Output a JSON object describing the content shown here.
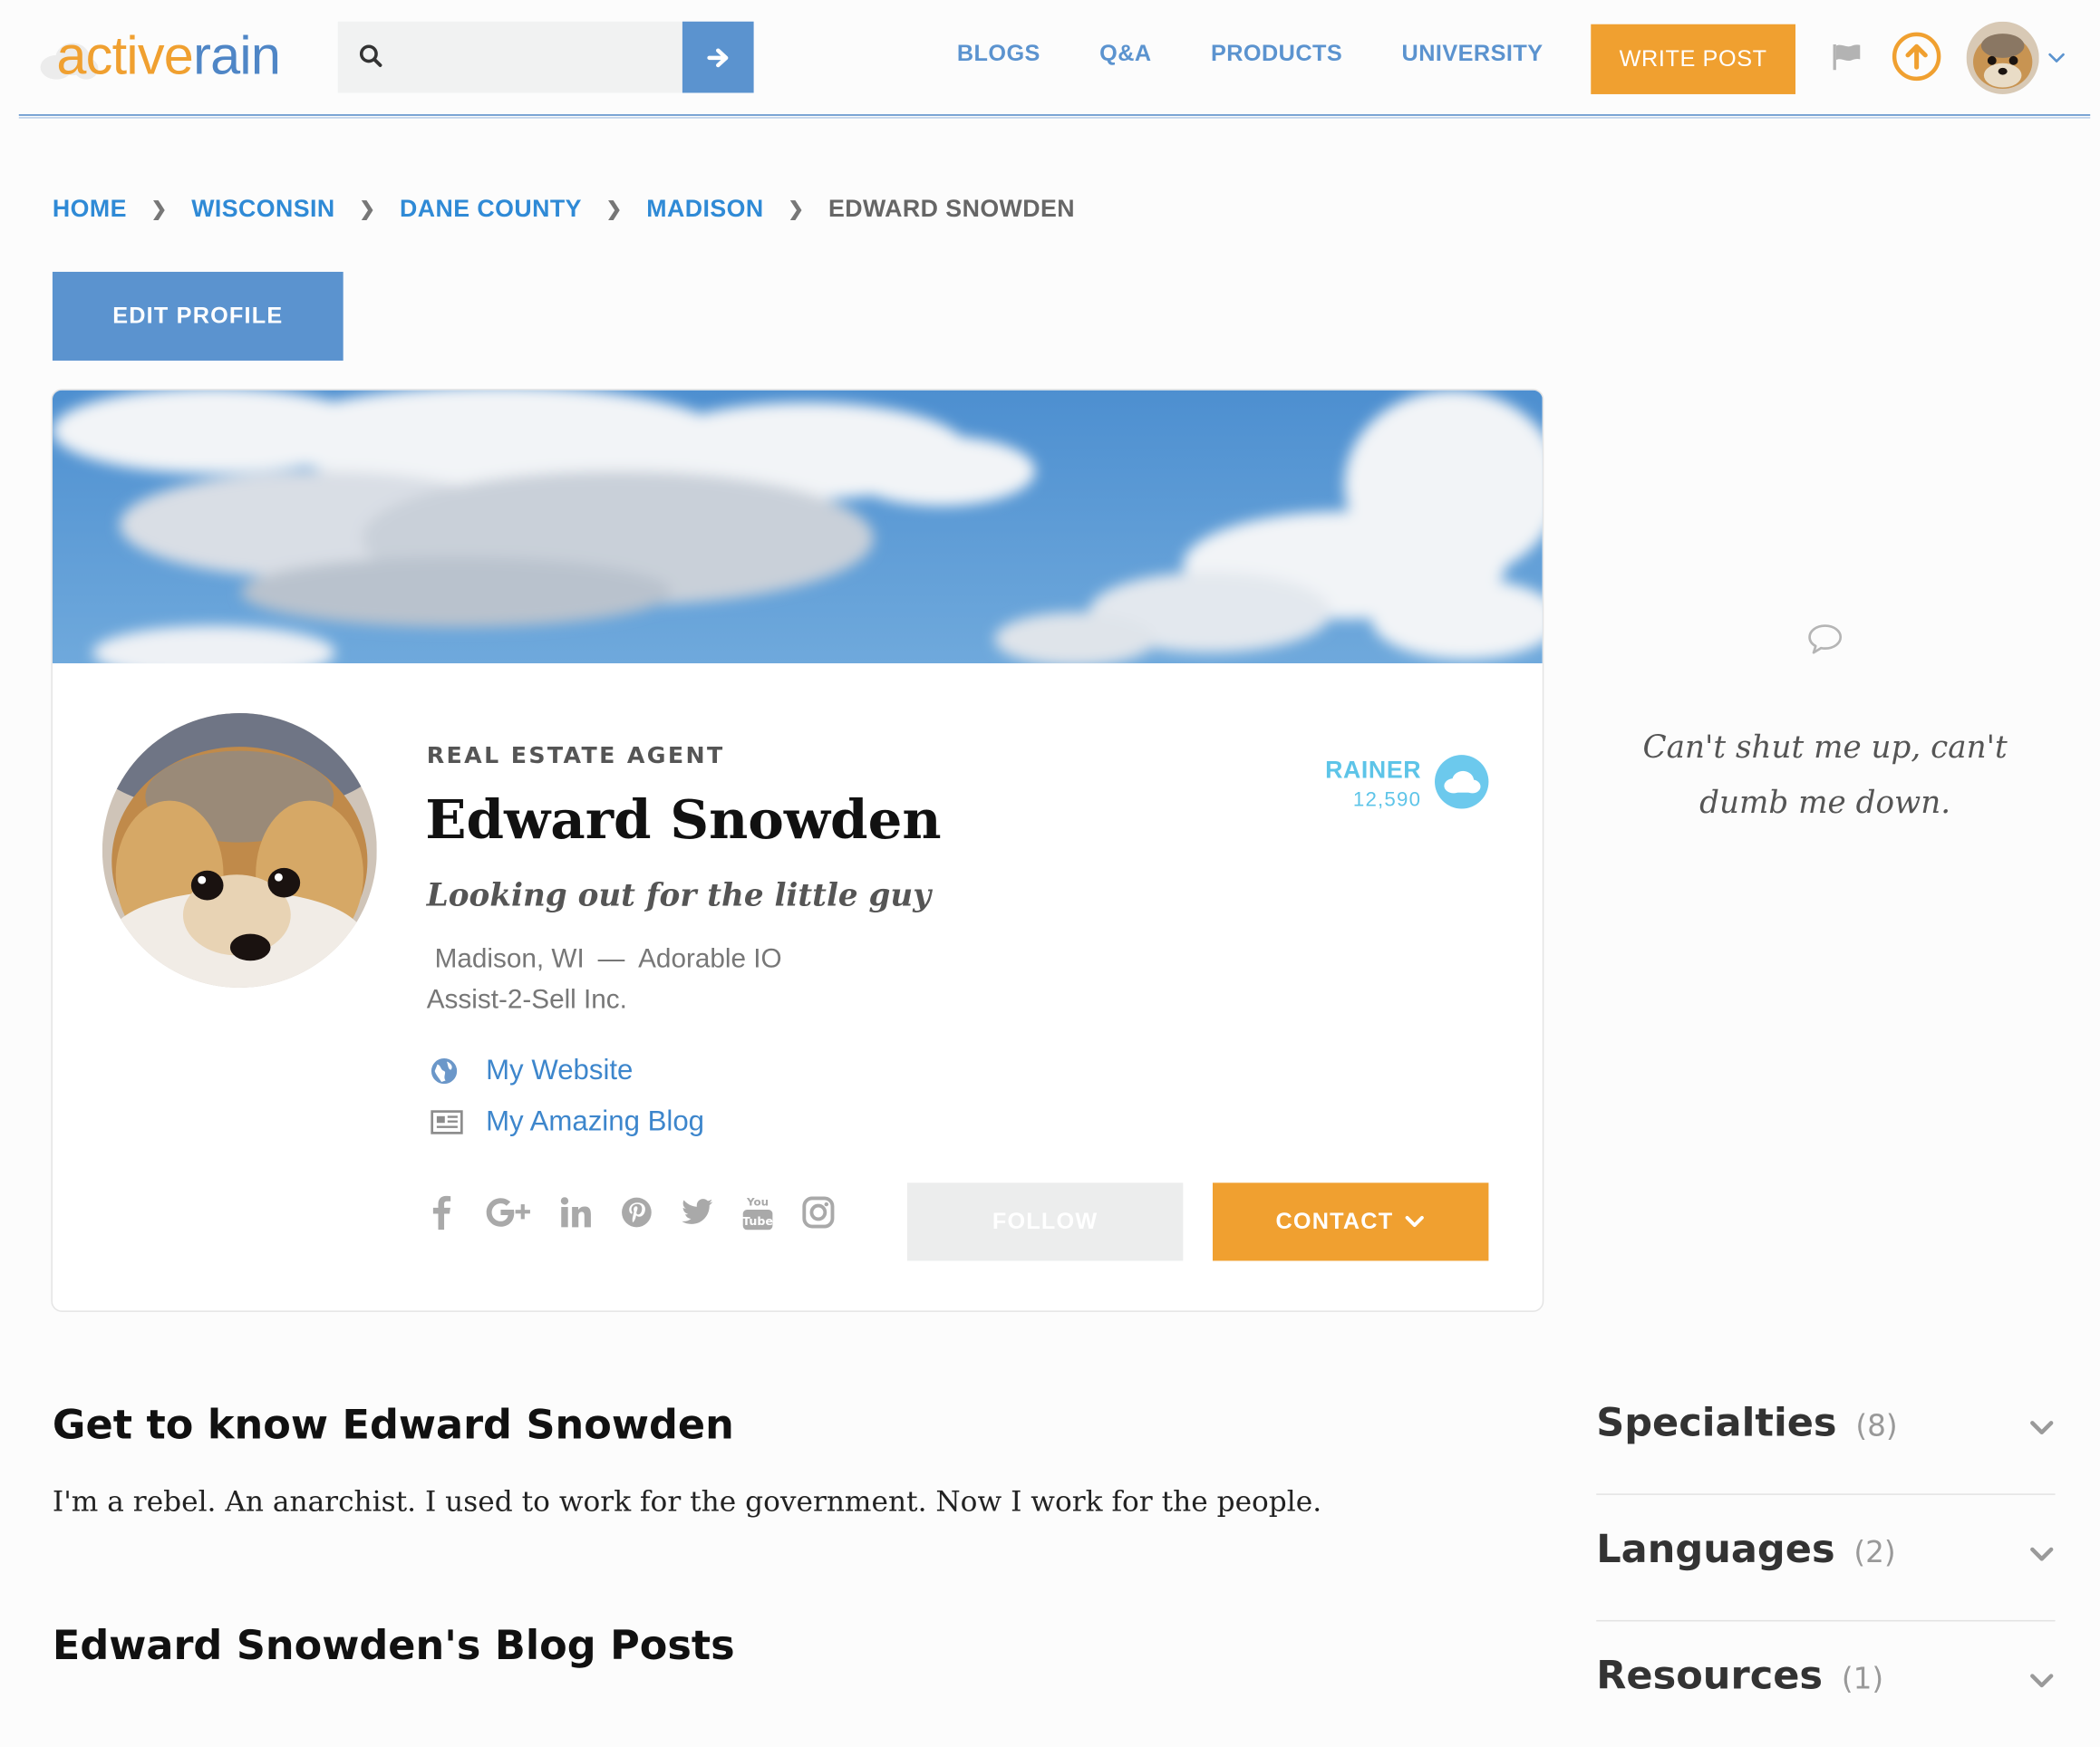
{
  "brand": {
    "logo_part1": "active",
    "logo_part2": "rain",
    "accent_orange": "#f0a030",
    "accent_blue": "#5b93cf",
    "link_blue": "#2f8ad6",
    "rank_cyan": "#5dc4e8"
  },
  "header": {
    "search": {
      "placeholder": "",
      "value": ""
    },
    "nav": [
      {
        "label": "BLOGS"
      },
      {
        "label": "Q&A"
      },
      {
        "label": "PRODUCTS"
      },
      {
        "label": "UNIVERSITY"
      }
    ],
    "write_post_label": "WRITE POST",
    "icons": [
      "search-icon",
      "arrow-right-icon",
      "flag-icon",
      "upload-arrow-icon",
      "chevron-down-icon"
    ]
  },
  "breadcrumb": [
    {
      "label": "HOME"
    },
    {
      "label": "WISCONSIN"
    },
    {
      "label": "DANE COUNTY"
    },
    {
      "label": "MADISON"
    },
    {
      "label": "EDWARD SNOWDEN"
    }
  ],
  "edit_profile_label": "EDIT PROFILE",
  "profile": {
    "role": "REAL ESTATE AGENT",
    "name": "Edward Snowden",
    "tagline": "Looking out for the little guy",
    "location": "Madison, WI",
    "separator": "—",
    "office": "Adorable IO",
    "company": "Assist-2-Sell Inc.",
    "links": [
      {
        "label": "My Website",
        "icon": "globe-icon"
      },
      {
        "label": "My Amazing Blog",
        "icon": "newspaper-icon"
      }
    ],
    "socials": [
      "facebook-icon",
      "google-plus-icon",
      "linkedin-icon",
      "pinterest-icon",
      "twitter-icon",
      "youtube-icon",
      "instagram-icon"
    ],
    "follow_label": "FOLLOW",
    "contact_label": "CONTACT",
    "rank": {
      "label": "RAINER",
      "points": "12,590"
    }
  },
  "sidebar": {
    "quote": "Can't shut me up, can't dumb me down.",
    "sections": [
      {
        "title": "Specialties",
        "count": "(8)"
      },
      {
        "title": "Languages",
        "count": "(2)"
      },
      {
        "title": "Resources",
        "count": "(1)"
      }
    ]
  },
  "main": {
    "about_heading": "Get to know Edward Snowden",
    "about_text": "I'm a rebel. An anarchist. I used to work for the government. Now I work for the people.",
    "posts_heading": "Edward Snowden's Blog Posts"
  }
}
